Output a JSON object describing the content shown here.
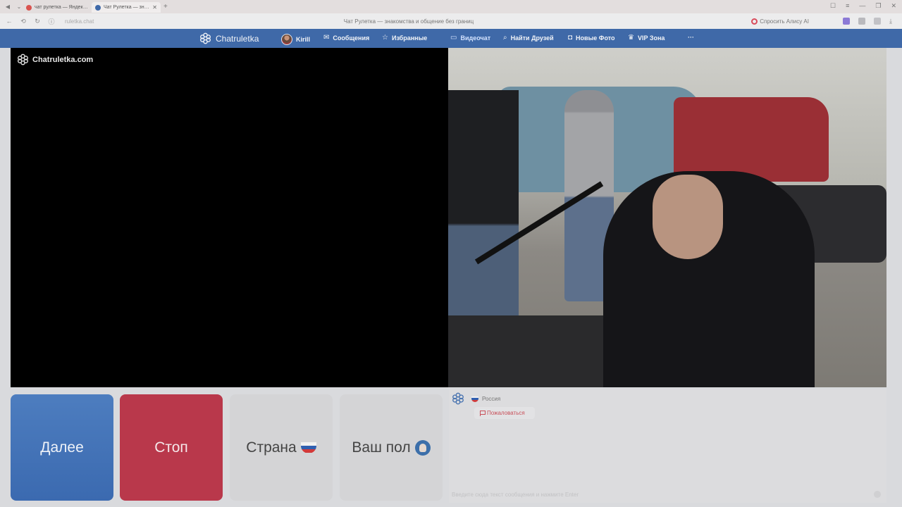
{
  "browser": {
    "tabs": [
      {
        "title": "чат рулетка — Яндекс: нашлось",
        "favicon_color": "#d9534f",
        "active": false
      },
      {
        "title": "Чат Рулетка — знакомства",
        "favicon_color": "#3f69a8",
        "active": true
      }
    ],
    "url": "ruletka.chat",
    "page_title": "Чат Рулетка — знакомства и общение без границ",
    "alice_label": "Спросить Алису AI"
  },
  "site": {
    "brand": "Chatruletka",
    "nav": {
      "user": "Kirill",
      "messages": "Сообщения",
      "favorites": "Избранные",
      "videochat": "Видеочат",
      "find_friends": "Найти Друзей",
      "new_photos": "Новые Фото",
      "vip": "VIP Зона",
      "more": "···"
    }
  },
  "video": {
    "watermark": "Chatruletka.com"
  },
  "controls": {
    "next": "Далее",
    "stop": "Стоп",
    "country": "Страна",
    "gender": "Ваш пол"
  },
  "chat": {
    "partner_country": "Россия",
    "report": "Пожаловаться",
    "input_placeholder": "Введите сюда текст сообщения и нажмите Enter"
  },
  "colors": {
    "brand_blue": "#3f69a8",
    "next_blue": "#4573b7",
    "stop_red": "#b9384b"
  }
}
